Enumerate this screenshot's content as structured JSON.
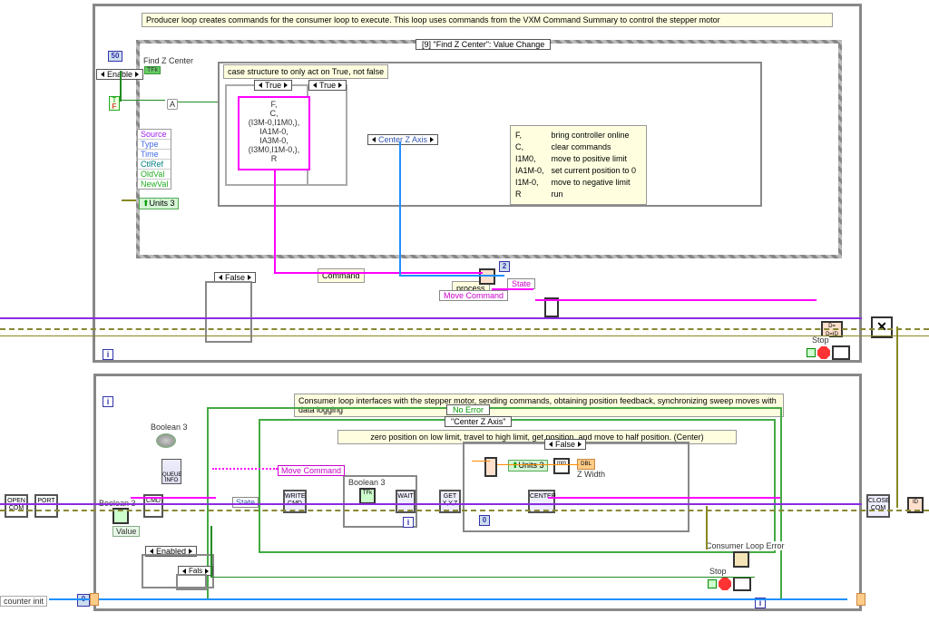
{
  "producer": {
    "comment_top": "Producer loop creates commands for the consumer loop to execute. This loop uses commands from the VXM Command Summary to control the stepper motor",
    "event_case": "[9] \"Find Z Center\": Value Change",
    "find_z_label": "Find Z Center",
    "case_note": "case structure to only act on True, not false",
    "case_outer": "True",
    "case_inner": "True",
    "formula": "F,\nC,\n(I3M-0,I1M0,),\nIA1M-0,\nIA3M-0,\n(I3M0,I1M-0,),\nR",
    "center_z": "Center Z Axis",
    "enable": "Enable",
    "source": "Source",
    "type": "Type",
    "time": "Time",
    "ctlref": "CtlRef",
    "oldval": "OldVal",
    "newval": "NewVal",
    "units3": "Units 3",
    "bottom_case": "False",
    "command_lbl": "Command",
    "process_lbl": "process",
    "state_lbl": "State",
    "move_cmd": "Move Command",
    "stop": "Stop",
    "n50": "50",
    "A": "A",
    "two": "2"
  },
  "legend": {
    "r1k": "F,",
    "r1v": "bring controller online",
    "r2k": "C,",
    "r2v": "clear commands",
    "r3k": "I1M0,",
    "r3v": "move to positive limit",
    "r4k": "IA1M-0,",
    "r4v": "set current position to 0",
    "r5k": "I1M-0,",
    "r5v": "move to negative limit",
    "r6k": "R",
    "r6v": "run"
  },
  "consumer": {
    "comment_top": "Consumer loop interfaces with the stepper motor, sending commands, obtaining position feedback, synchronizing sweep moves with data logging",
    "no_error": "No Error",
    "center_z": "\"Center Z Axis\"",
    "desc": "zero position on low limit, travel to high limit, get position, and move to half position. (Center)",
    "false": "False",
    "move_cmd": "Move Command",
    "state": "State",
    "boolean3": "Boolean 3",
    "boolean3_ind": "Boolean 3",
    "enabled": "Enabled",
    "fals": "Fals",
    "units3": "Units 3",
    "zwidth": "Z Width",
    "consumer_err": "Consumer Loop Error",
    "stop": "Stop",
    "wait": "WAIT",
    "counter_init": "counter init",
    "value": "Value",
    "get": "GET\nX,Y,Z",
    "center": "CENTER",
    "wr_cmd": "WRITE\nCMD",
    "cmd": "CMD",
    "port": "PORT",
    "open_com": "OPEN\nCOM",
    "close_com": "CLOSE\nCOM",
    "queue": "QUEUE\nINFO"
  }
}
